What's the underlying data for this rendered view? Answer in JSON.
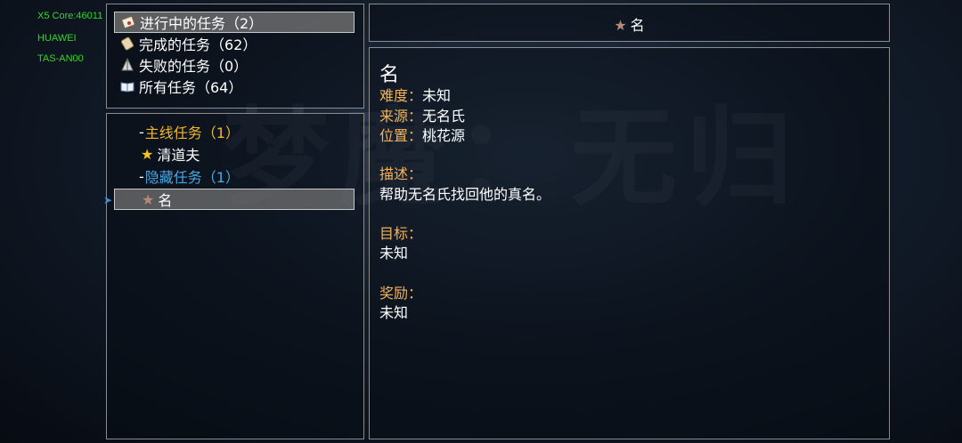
{
  "device": {
    "core": "X5 Core:46011",
    "brand": "HUAWEI",
    "model": "TAS-AN00"
  },
  "background_text": "梦魔：无归",
  "categories": [
    {
      "label": "进行中的任务（2）",
      "icon": "scroll-icon",
      "selected": true
    },
    {
      "label": "完成的任务（62）",
      "icon": "rolled-scroll-icon",
      "selected": false
    },
    {
      "label": "失败的任务（0）",
      "icon": "broken-sail-icon",
      "selected": false
    },
    {
      "label": "所有任务（64）",
      "icon": "open-book-icon",
      "selected": false
    }
  ],
  "tree": {
    "main_group": "主线任务（1）",
    "main_quest": "清道夫",
    "hidden_group": "隐藏任务（1）",
    "hidden_quest": "名"
  },
  "detail": {
    "header_title": "名",
    "name": "名",
    "difficulty_label": "难度：",
    "difficulty_value": "未知",
    "source_label": "来源：",
    "source_value": "无名氏",
    "location_label": "位置：",
    "location_value": "桃花源",
    "desc_label": "描述：",
    "desc_value": "帮助无名氏找回他的真名。",
    "goal_label": "目标：",
    "goal_value": "未知",
    "reward_label": "奖励：",
    "reward_value": "未知"
  },
  "colors": {
    "label": "#f2b35a",
    "main_group": "#f2b632",
    "hidden_group": "#4ba6e0",
    "device_text": "#38d22c"
  }
}
